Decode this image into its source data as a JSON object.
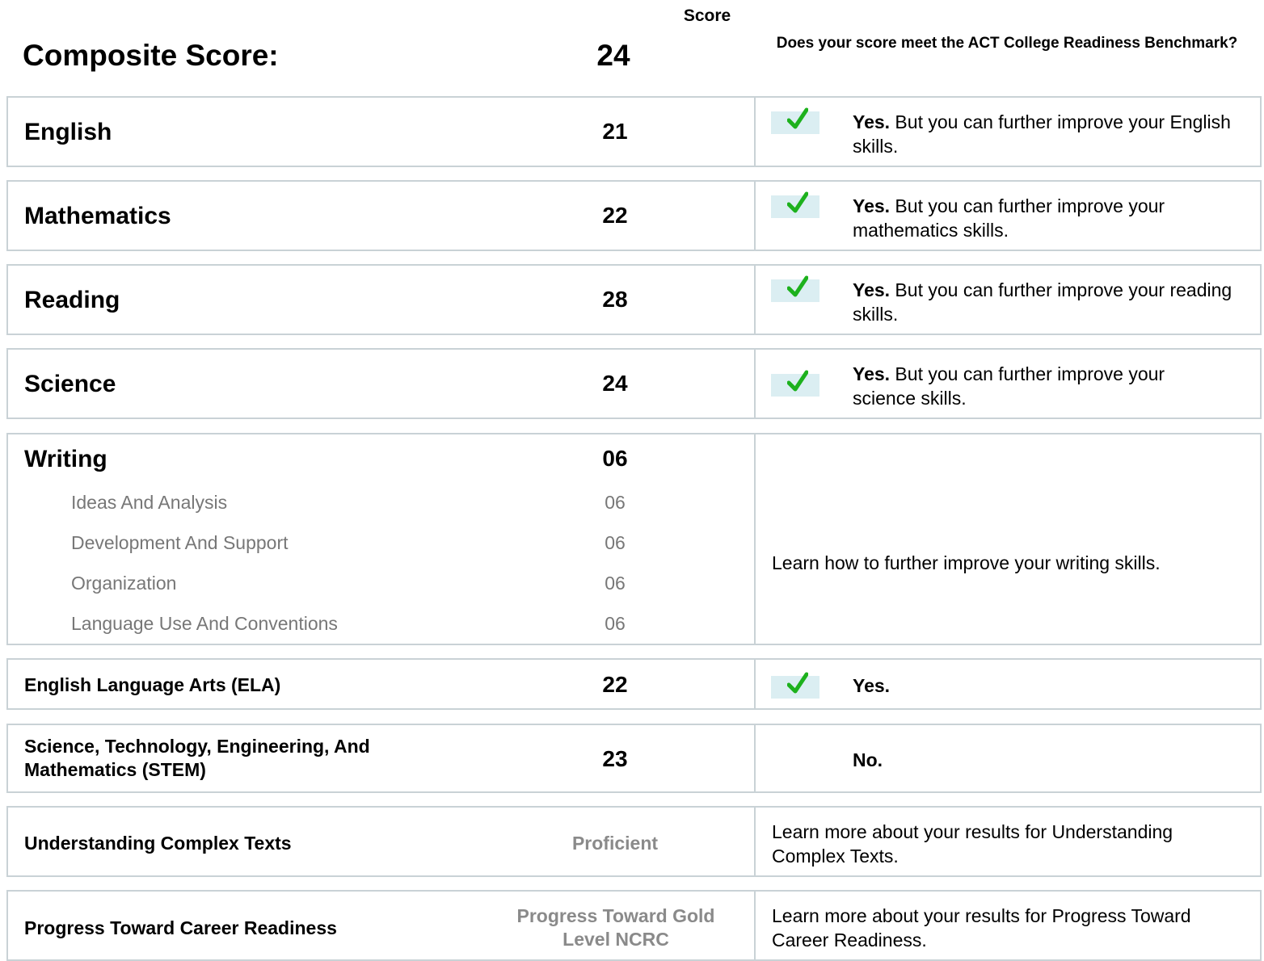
{
  "header": {
    "score_label": "Score",
    "composite_label": "Composite Score:",
    "composite_value": "24",
    "benchmark_question": "Does your score meet the ACT College Readiness Benchmark?"
  },
  "rows": {
    "english": {
      "subject": "English",
      "score": "21",
      "answer": "Yes.",
      "message": " But you can further improve your English skills.",
      "check_icon": "check-icon"
    },
    "mathematics": {
      "subject": "Mathematics",
      "score": "22",
      "answer": "Yes.",
      "message": " But you can further improve your mathematics skills.",
      "check_icon": "check-icon"
    },
    "reading": {
      "subject": "Reading",
      "score": "28",
      "answer": "Yes.",
      "message": " But you can further improve your reading skills.",
      "check_icon": "check-icon"
    },
    "science": {
      "subject": "Science",
      "score": "24",
      "answer": "Yes.",
      "message": " But you can further improve your science skills.",
      "check_icon": "check-icon"
    },
    "writing": {
      "subject": "Writing",
      "score": "06",
      "domains": [
        {
          "label": "Ideas And Analysis",
          "score": "06"
        },
        {
          "label": "Development And Support",
          "score": "06"
        },
        {
          "label": "Organization",
          "score": "06"
        },
        {
          "label": "Language Use And Conventions",
          "score": "06"
        }
      ],
      "link": "Learn how to further improve your writing skills."
    },
    "ela": {
      "subject": "English Language Arts (ELA)",
      "score": "22",
      "answer": "Yes.",
      "check_icon": "check-icon"
    },
    "stem": {
      "subject": "Science, Technology, Engineering, And Mathematics (STEM)",
      "score": "23",
      "answer": "No."
    },
    "uct": {
      "subject": "Understanding Complex Texts",
      "score": "Proficient",
      "link": "Learn more about your results for Understanding Complex Texts."
    },
    "career": {
      "subject": "Progress Toward Career Readiness",
      "score": "Progress Toward Gold Level NCRC",
      "link": "Learn more about your results for Progress Toward Career Readiness."
    }
  },
  "colors": {
    "border": "#c9d2d6",
    "check_green": "#1db11d",
    "check_bg": "#dbeef2",
    "muted_text": "#777777"
  }
}
